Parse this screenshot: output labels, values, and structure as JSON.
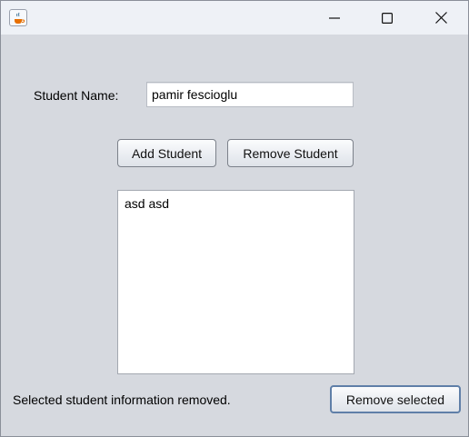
{
  "window": {
    "icon": "java-coffee-cup-icon",
    "controls": [
      "minimize-icon",
      "maximize-icon",
      "close-icon"
    ]
  },
  "form": {
    "name_label": "Student Name:",
    "name_value": "pamir fescioglu",
    "add_label": "Add Student",
    "remove_label": "Remove Student"
  },
  "list": {
    "items": [
      {
        "label": "asd asd"
      }
    ]
  },
  "footer": {
    "status": "Selected student information removed.",
    "remove_selected_label": "Remove selected"
  },
  "colors": {
    "window_bg": "#d6d9df",
    "titlebar_bg": "#eef1f6",
    "focus_border": "#5f7fa8"
  }
}
